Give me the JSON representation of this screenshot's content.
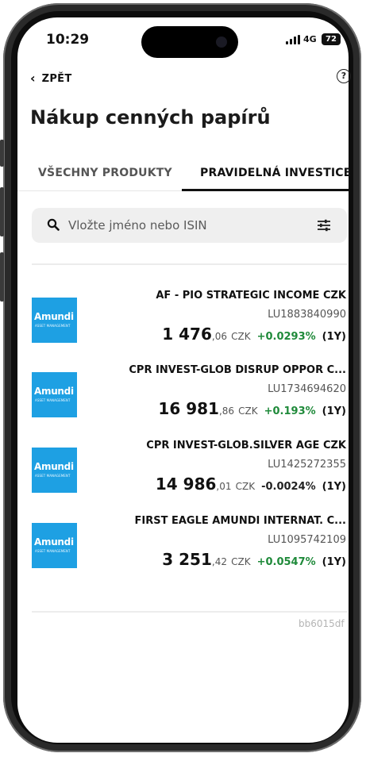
{
  "status": {
    "time": "10:29",
    "network": "4G",
    "battery": "72"
  },
  "nav": {
    "back_label": "ZPĚT",
    "help_glyph": "?"
  },
  "page": {
    "title": "Nákup cenných papírů"
  },
  "tabs": [
    {
      "label": "VŠECHNY PRODUKTY",
      "active": false
    },
    {
      "label": "PRAVIDELNÁ INVESTICE",
      "active": true
    }
  ],
  "search": {
    "placeholder": "Vložte jméno nebo ISIN",
    "icon": "search-icon",
    "filter_icon": "filter-sliders-icon"
  },
  "products": [
    {
      "name": "AF - PIO STRATEGIC INCOME CZK",
      "isin": "LU1883840990",
      "price_int": "1 476",
      "price_dec": ",06",
      "currency": "CZK",
      "change": "+0.0293%",
      "change_dir": "up",
      "period": "(1Y)",
      "logo_text": "Amundi",
      "logo_sub": "ASSET MANAGEMENT"
    },
    {
      "name": "CPR INVEST-GLOB DISRUP OPPOR C...",
      "isin": "LU1734694620",
      "price_int": "16 981",
      "price_dec": ",86",
      "currency": "CZK",
      "change": "+0.193%",
      "change_dir": "up",
      "period": "(1Y)",
      "logo_text": "Amundi",
      "logo_sub": "ASSET MANAGEMENT"
    },
    {
      "name": "CPR INVEST-GLOB.SILVER AGE CZK",
      "isin": "LU1425272355",
      "price_int": "14 986",
      "price_dec": ",01",
      "currency": "CZK",
      "change": "-0.0024%",
      "change_dir": "down",
      "period": "(1Y)",
      "logo_text": "Amundi",
      "logo_sub": "ASSET MANAGEMENT"
    },
    {
      "name": "FIRST EAGLE AMUNDI INTERNAT. C...",
      "isin": "LU1095742109",
      "price_int": "3 251",
      "price_dec": ",42",
      "currency": "CZK",
      "change": "+0.0547%",
      "change_dir": "up",
      "period": "(1Y)",
      "logo_text": "Amundi",
      "logo_sub": "ASSET MANAGEMENT"
    }
  ],
  "footer": {
    "build_hash": "bb6015df"
  },
  "colors": {
    "positive": "#1f8a3a",
    "logo_bg": "#1ea0e3",
    "search_bg": "#efefef"
  }
}
